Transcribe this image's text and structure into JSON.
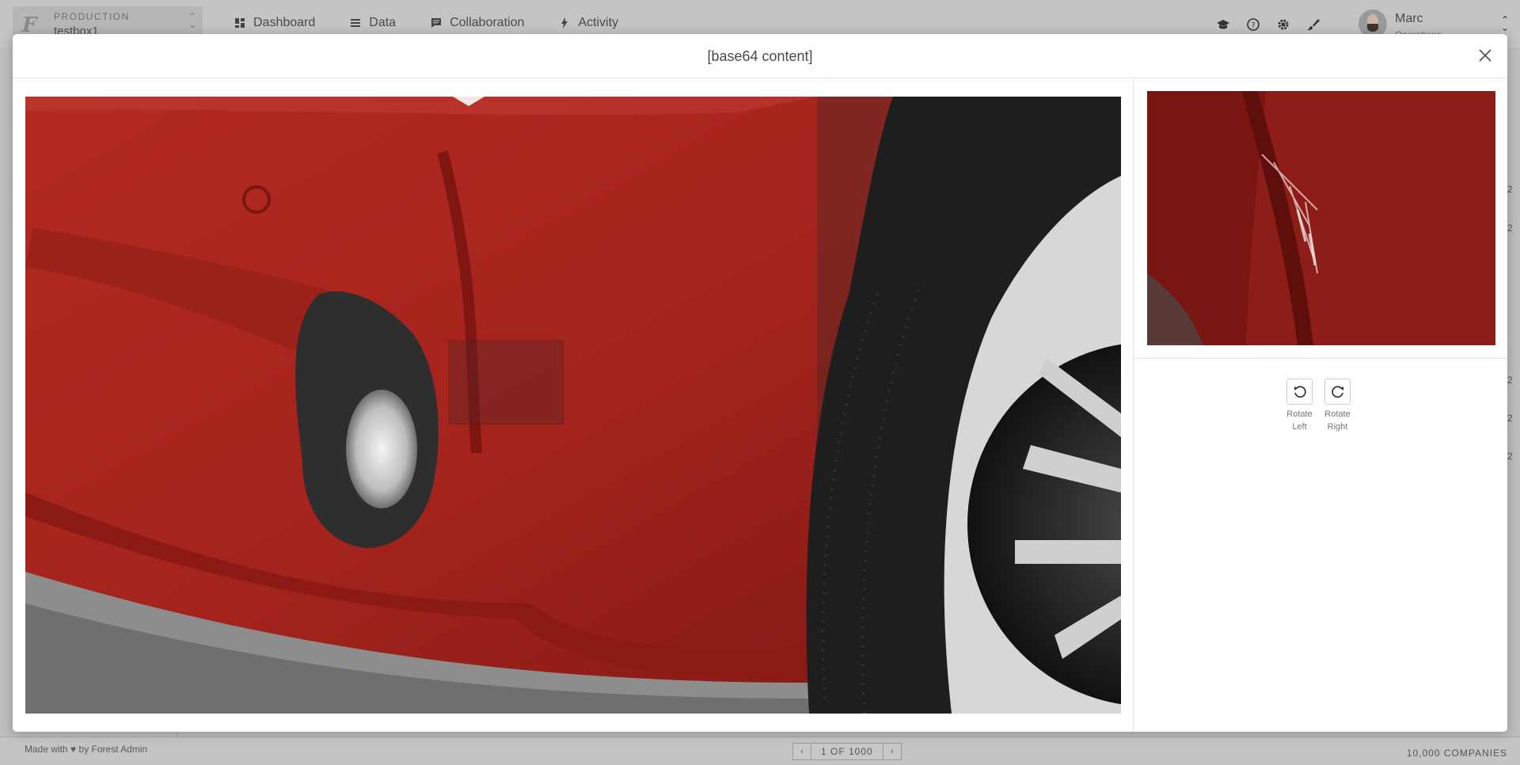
{
  "environment": {
    "label": "PRODUCTION",
    "project": "testbox1"
  },
  "nav": [
    {
      "label": "Dashboard",
      "icon": "dashboard-icon"
    },
    {
      "label": "Data",
      "icon": "list-icon"
    },
    {
      "label": "Collaboration",
      "icon": "chat-icon"
    },
    {
      "label": "Activity",
      "icon": "bolt-icon"
    }
  ],
  "header_tools": [
    "graduation-cap-icon",
    "help-icon",
    "gear-icon",
    "brush-icon"
  ],
  "user": {
    "name": "Marc",
    "role": "Operations"
  },
  "footer": {
    "made_with_prefix": "Made with",
    "made_with_suffix": "by Forest Admin",
    "pagination": "1 OF 1000",
    "record_count": "10,000 COMPANIES"
  },
  "peek_values": [
    "2",
    "2",
    "2",
    "2",
    "2"
  ],
  "modal": {
    "title": "[base64 content]",
    "rotate_left": "Rotate Left",
    "rotate_right": "Rotate Right"
  },
  "colors": {
    "overlay": "#bdbdbd",
    "car_red": "#a4231d",
    "tire": "#1e1e1e"
  }
}
